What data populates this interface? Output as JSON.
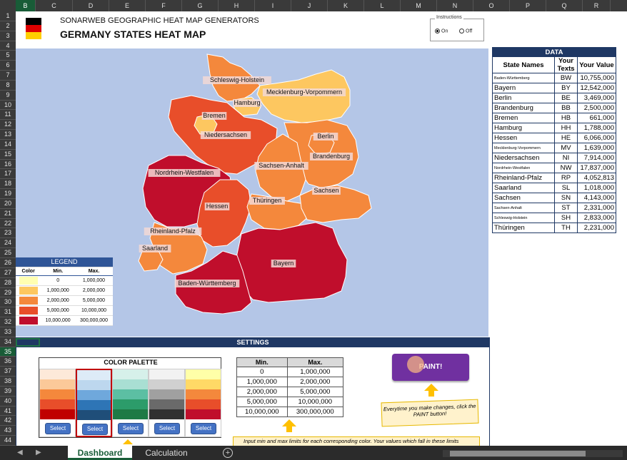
{
  "spreadsheet": {
    "columns": [
      "B",
      "C",
      "D",
      "E",
      "F",
      "G",
      "H",
      "I",
      "J",
      "K",
      "L",
      "M",
      "N",
      "O",
      "P",
      "Q",
      "R"
    ],
    "selected_column": "B",
    "rows": [
      "1",
      "2",
      "3",
      "4",
      "5",
      "6",
      "7",
      "8",
      "9",
      "10",
      "11",
      "12",
      "13",
      "14",
      "15",
      "16",
      "17",
      "18",
      "19",
      "20",
      "21",
      "22",
      "23",
      "24",
      "25",
      "26",
      "27",
      "28",
      "29",
      "30",
      "31",
      "32",
      "33",
      "34",
      "35",
      "36",
      "37",
      "38",
      "39",
      "40",
      "41",
      "42",
      "43",
      "44"
    ],
    "selected_row": "35"
  },
  "header": {
    "subtitle": "SONARWEB GEOGRAPHIC HEAT MAP GENERATORS",
    "title": "GERMANY STATES HEAT MAP",
    "flag_colors": [
      "#000000",
      "#dd0000",
      "#ffce00"
    ]
  },
  "instructions": {
    "label": "Instructions",
    "on_label": "On",
    "off_label": "Off",
    "selected": "On"
  },
  "map": {
    "background": "#b4c6e7",
    "states": [
      {
        "name": "Schleswig-Holstein",
        "color": "#f4883c"
      },
      {
        "name": "Mecklenburg-Vorpommern",
        "color": "#fdc760"
      },
      {
        "name": "Hamburg",
        "color": "#fdc760"
      },
      {
        "name": "Bremen",
        "color": "#fdc760"
      },
      {
        "name": "Niedersachsen",
        "color": "#e84e2a"
      },
      {
        "name": "Berlin",
        "color": "#f4883c"
      },
      {
        "name": "Brandenburg",
        "color": "#f4883c"
      },
      {
        "name": "Sachsen-Anhalt",
        "color": "#f4883c"
      },
      {
        "name": "Nordrhein-Westfalen",
        "color": "#c00e2c"
      },
      {
        "name": "Hessen",
        "color": "#e84e2a"
      },
      {
        "name": "Thüringen",
        "color": "#f4883c"
      },
      {
        "name": "Sachsen",
        "color": "#f4883c"
      },
      {
        "name": "Rheinland-Pfalz",
        "color": "#f4883c"
      },
      {
        "name": "Saarland",
        "color": "#f4883c"
      },
      {
        "name": "Bayern",
        "color": "#c00e2c"
      },
      {
        "name": "Baden-Württemberg",
        "color": "#c00e2c"
      }
    ]
  },
  "data_table": {
    "title": "DATA",
    "headers": [
      "State Names",
      "Your Texts",
      "Your Value"
    ],
    "rows": [
      {
        "name": "Baden-Württemberg",
        "text": "BW",
        "value": "10,755,000",
        "small": true
      },
      {
        "name": "Bayern",
        "text": "BY",
        "value": "12,542,000",
        "small": false
      },
      {
        "name": "Berlin",
        "text": "BE",
        "value": "3,469,000",
        "small": false
      },
      {
        "name": "Brandenburg",
        "text": "BB",
        "value": "2,500,000",
        "small": false
      },
      {
        "name": "Bremen",
        "text": "HB",
        "value": "661,000",
        "small": false
      },
      {
        "name": "Hamburg",
        "text": "HH",
        "value": "1,788,000",
        "small": false
      },
      {
        "name": "Hessen",
        "text": "HE",
        "value": "6,066,000",
        "small": false
      },
      {
        "name": "Mecklenburg-Vorpommern",
        "text": "MV",
        "value": "1,639,000",
        "small": true
      },
      {
        "name": "Niedersachsen",
        "text": "NI",
        "value": "7,914,000",
        "small": false
      },
      {
        "name": "Nordrhein-Westfalen",
        "text": "NW",
        "value": "17,837,000",
        "small": true
      },
      {
        "name": "Rheinland-Pfalz",
        "text": "RP",
        "value": "4,052,813",
        "small": false
      },
      {
        "name": "Saarland",
        "text": "SL",
        "value": "1,018,000",
        "small": false
      },
      {
        "name": "Sachsen",
        "text": "SN",
        "value": "4,143,000",
        "small": false
      },
      {
        "name": "Sachsen-Anhalt",
        "text": "ST",
        "value": "2,331,000",
        "small": true
      },
      {
        "name": "Schleswig-Holstein",
        "text": "SH",
        "value": "2,833,000",
        "small": true
      },
      {
        "name": "Thüringen",
        "text": "TH",
        "value": "2,231,000",
        "small": false
      }
    ]
  },
  "legend": {
    "title": "LEGEND",
    "headers": [
      "Color",
      "Min.",
      "Max."
    ],
    "rows": [
      {
        "color": "#ffffb2",
        "min": "0",
        "max": "1,000,000"
      },
      {
        "color": "#fdc760",
        "min": "1,000,000",
        "max": "2,000,000"
      },
      {
        "color": "#f4883c",
        "min": "2,000,000",
        "max": "5,000,000"
      },
      {
        "color": "#e84e2a",
        "min": "5,000,000",
        "max": "10,000,000"
      },
      {
        "color": "#c00e2c",
        "min": "10,000,000",
        "max": "300,000,000"
      }
    ]
  },
  "settings": {
    "title": "SETTINGS",
    "palette_title": "COLOR PALETTE",
    "select_label": "Select",
    "active_palette": 1,
    "palettes": [
      [
        "#fde9d9",
        "#fbc999",
        "#f4883c",
        "#e84e2a",
        "#c00000"
      ],
      [
        "#ddebf7",
        "#bdd7ee",
        "#6fa8dc",
        "#2e75b6",
        "#1f4e79"
      ],
      [
        "#d6f0ea",
        "#a9dfd3",
        "#5cbfa3",
        "#2c9c6a",
        "#1e7a45"
      ],
      [
        "#f2f2f2",
        "#d0d0d0",
        "#a0a0a0",
        "#6a6a6a",
        "#303030"
      ],
      [
        "#ffffa8",
        "#ffd966",
        "#f4883c",
        "#e84e2a",
        "#c00e2c"
      ]
    ],
    "minmax_headers": [
      "Min.",
      "Max."
    ],
    "minmax_rows": [
      [
        "0",
        "1,000,000"
      ],
      [
        "1,000,000",
        "2,000,000"
      ],
      [
        "2,000,000",
        "5,000,000"
      ],
      [
        "5,000,000",
        "10,000,000"
      ],
      [
        "10,000,000",
        "300,000,000"
      ]
    ],
    "paint_label": "PAINT!",
    "note_changes": "Everytime you make changes, click the PAINT button!",
    "note_limits": "Input min and max limits for each corresponding color. Your values which fall in these limits"
  },
  "tabs": {
    "items": [
      "Dashboard",
      "Calculation"
    ],
    "active": "Dashboard"
  }
}
